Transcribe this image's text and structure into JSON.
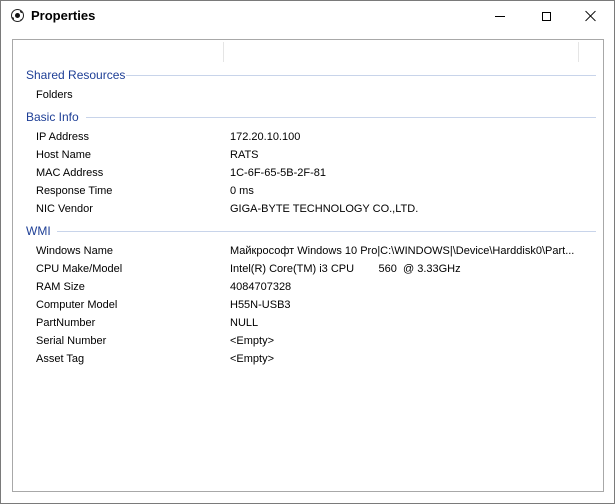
{
  "window": {
    "title": "Properties",
    "app_icon": "soccer-ball-icon"
  },
  "groups": {
    "shared": {
      "title": "Shared Resources",
      "rows": [
        {
          "label": "Folders",
          "value": ""
        }
      ]
    },
    "basic": {
      "title": "Basic Info",
      "rows": [
        {
          "label": "IP Address",
          "value": "172.20.10.100"
        },
        {
          "label": "Host Name",
          "value": "RATS"
        },
        {
          "label": "MAC Address",
          "value": "1C-6F-65-5B-2F-81"
        },
        {
          "label": "Response Time",
          "value": "0 ms"
        },
        {
          "label": "NIC Vendor",
          "value": "GIGA-BYTE TECHNOLOGY CO.,LTD."
        }
      ]
    },
    "wmi": {
      "title": "WMI",
      "rows": [
        {
          "label": "Windows Name",
          "value": "Майкрософт Windows 10 Pro|C:\\WINDOWS|\\Device\\Harddisk0\\Part..."
        },
        {
          "label": "CPU Make/Model",
          "value": "Intel(R) Core(TM) i3 CPU        560  @ 3.33GHz"
        },
        {
          "label": "RAM Size",
          "value": "4084707328"
        },
        {
          "label": "Computer Model",
          "value": "H55N-USB3"
        },
        {
          "label": "PartNumber",
          "value": "NULL"
        },
        {
          "label": "Serial Number",
          "value": "<Empty>"
        },
        {
          "label": "Asset Tag",
          "value": "<Empty>"
        }
      ]
    }
  },
  "colors": {
    "group_header": "#1e3f96",
    "group_line": "#c8d4ea",
    "panel_border": "#a8a8a8"
  }
}
